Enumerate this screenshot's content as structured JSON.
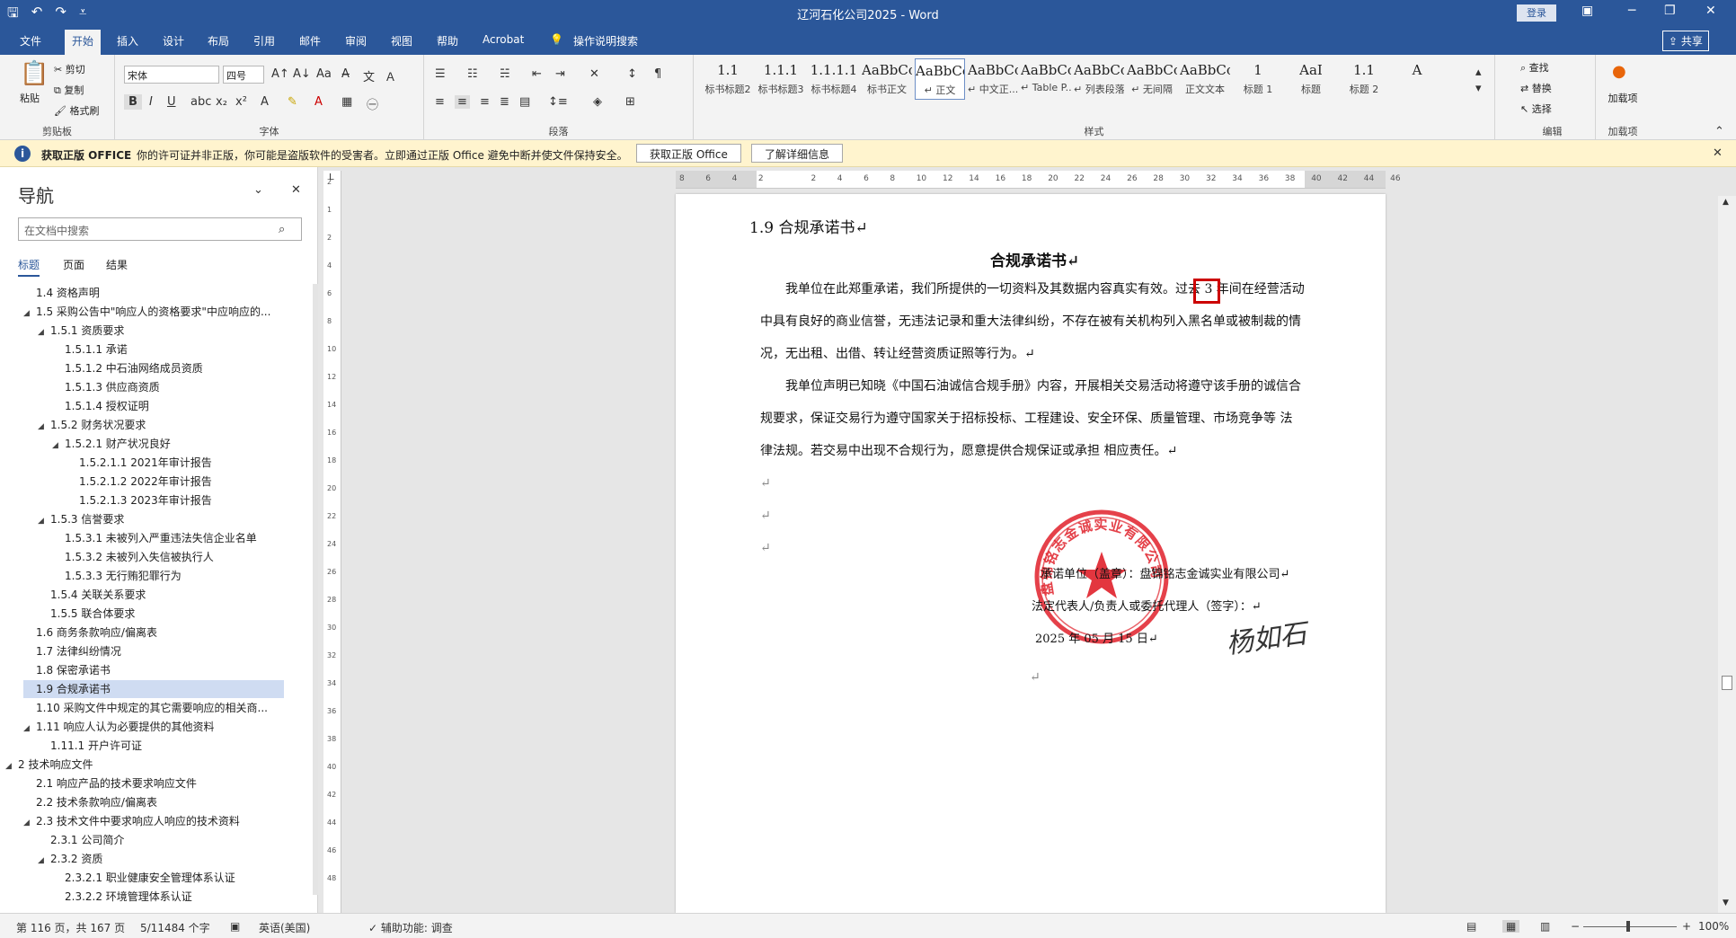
{
  "window": {
    "title": "辽河石化公司2025  -  Word",
    "login_label": "登录"
  },
  "tabs": [
    "文件",
    "开始",
    "插入",
    "设计",
    "布局",
    "引用",
    "邮件",
    "审阅",
    "视图",
    "帮助",
    "Acrobat",
    "操作说明搜索"
  ],
  "share_label": "共享",
  "ribbon": {
    "clipboard": {
      "paste": "粘贴",
      "cut": "剪切",
      "copy": "复制",
      "format_painter": "格式刷",
      "label": "剪贴板"
    },
    "font": {
      "name": "宋体",
      "size": "四号",
      "label": "字体"
    },
    "paragraph": {
      "label": "段落"
    },
    "styles": {
      "label": "样式",
      "items": [
        {
          "preview": "1.1",
          "name": "标书标题2"
        },
        {
          "preview": "1.1.1",
          "name": "标书标题3"
        },
        {
          "preview": "1.1.1.1",
          "name": "标书标题4"
        },
        {
          "preview": "AaBbCcDdE",
          "name": "标书正文"
        },
        {
          "preview": "AaBbCcD",
          "name": "↵ 正文"
        },
        {
          "preview": "AaBbCcDd",
          "name": "↵ 中文正..."
        },
        {
          "preview": "AaBbCcDd",
          "name": "↵ Table P..."
        },
        {
          "preview": "AaBbCcDd",
          "name": "↵ 列表段落"
        },
        {
          "preview": "AaBbCcDd",
          "name": "↵ 无间隔"
        },
        {
          "preview": "AaBbCcDd",
          "name": "正文文本"
        },
        {
          "preview": "1",
          "name": "标题 1"
        },
        {
          "preview": "AaI",
          "name": "标题"
        },
        {
          "preview": "1.1",
          "name": "标题 2"
        },
        {
          "preview": "A",
          "name": ""
        }
      ]
    },
    "editing": {
      "find": "查找",
      "replace": "替换",
      "select": "选择",
      "label": "编辑"
    },
    "addins": {
      "button": "加载项",
      "label": "加载项"
    }
  },
  "infobar": {
    "title": "获取正版 OFFICE",
    "text": "你的许可证并非正版，你可能是盗版软件的受害者。立即通过正版 Office 避免中断并使文件保持安全。",
    "btn1": "获取正版 Office",
    "btn2": "了解详细信息"
  },
  "nav": {
    "title": "导航",
    "search_placeholder": "在文档中搜索",
    "tabs": [
      "标题",
      "页面",
      "结果"
    ],
    "items": [
      {
        "label": "1.4 资格声明",
        "level": 2,
        "tri": ""
      },
      {
        "label": "1.5 采购公告中\"响应人的资格要求\"中应响应的...",
        "level": 2,
        "tri": "◢"
      },
      {
        "label": "1.5.1 资质要求",
        "level": 3,
        "tri": "◢"
      },
      {
        "label": "1.5.1.1 承诺",
        "level": 4,
        "tri": ""
      },
      {
        "label": "1.5.1.2 中石油网络成员资质",
        "level": 4,
        "tri": ""
      },
      {
        "label": "1.5.1.3 供应商资质",
        "level": 4,
        "tri": ""
      },
      {
        "label": "1.5.1.4 授权证明",
        "level": 4,
        "tri": ""
      },
      {
        "label": "1.5.2 财务状况要求",
        "level": 3,
        "tri": "◢"
      },
      {
        "label": "1.5.2.1 财产状况良好",
        "level": 4,
        "tri": "◢"
      },
      {
        "label": "1.5.2.1.1 2021年审计报告",
        "level": 5,
        "tri": ""
      },
      {
        "label": "1.5.2.1.2 2022年审计报告",
        "level": 5,
        "tri": ""
      },
      {
        "label": "1.5.2.1.3 2023年审计报告",
        "level": 5,
        "tri": ""
      },
      {
        "label": "1.5.3 信誉要求",
        "level": 3,
        "tri": "◢"
      },
      {
        "label": "1.5.3.1 未被列入严重违法失信企业名单",
        "level": 4,
        "tri": ""
      },
      {
        "label": "1.5.3.2 未被列入失信被执行人",
        "level": 4,
        "tri": ""
      },
      {
        "label": "1.5.3.3 无行贿犯罪行为",
        "level": 4,
        "tri": ""
      },
      {
        "label": "1.5.4 关联关系要求",
        "level": 3,
        "tri": ""
      },
      {
        "label": "1.5.5 联合体要求",
        "level": 3,
        "tri": ""
      },
      {
        "label": "1.6 商务条款响应/偏离表",
        "level": 2,
        "tri": ""
      },
      {
        "label": "1.7 法律纠纷情况",
        "level": 2,
        "tri": ""
      },
      {
        "label": "1.8 保密承诺书",
        "level": 2,
        "tri": ""
      },
      {
        "label": "1.9 合规承诺书",
        "level": 2,
        "tri": "",
        "selected": true
      },
      {
        "label": "1.10 采购文件中规定的其它需要响应的相关商...",
        "level": 2,
        "tri": ""
      },
      {
        "label": "1.11 响应人认为必要提供的其他资料",
        "level": 2,
        "tri": "◢"
      },
      {
        "label": "1.11.1 开户许可证",
        "level": 3,
        "tri": ""
      },
      {
        "label": "2 技术响应文件",
        "level": 1,
        "tri": "◢"
      },
      {
        "label": "2.1 响应产品的技术要求响应文件",
        "level": 2,
        "tri": ""
      },
      {
        "label": "2.2 技术条款响应/偏离表",
        "level": 2,
        "tri": ""
      },
      {
        "label": "2.3 技术文件中要求响应人响应的技术资料",
        "level": 2,
        "tri": "◢"
      },
      {
        "label": "2.3.1 公司简介",
        "level": 3,
        "tri": ""
      },
      {
        "label": "2.3.2 资质",
        "level": 3,
        "tri": "◢"
      },
      {
        "label": "2.3.2.1 职业健康安全管理体系认证",
        "level": 4,
        "tri": ""
      },
      {
        "label": "2.3.2.2 环境管理体系认证",
        "level": 4,
        "tri": ""
      }
    ]
  },
  "ruler": {
    "numbers": [
      "8",
      "6",
      "4",
      "2",
      "",
      "2",
      "4",
      "6",
      "8",
      "10",
      "12",
      "14",
      "16",
      "18",
      "20",
      "22",
      "24",
      "26",
      "28",
      "30",
      "32",
      "34",
      "36",
      "38",
      "40",
      "42",
      "44",
      "46"
    ]
  },
  "vruler": {
    "numbers": [
      "2",
      "1",
      "2",
      "4",
      "6",
      "8",
      "10",
      "12",
      "14",
      "16",
      "18",
      "20",
      "22",
      "24",
      "26",
      "28",
      "30",
      "32",
      "34",
      "36",
      "38",
      "40",
      "42",
      "44",
      "46",
      "48"
    ]
  },
  "document": {
    "heading": "1.9    合规承诺书↵",
    "title": "合规承诺书↵",
    "para1_lines": [
      "我单位在此郑重承诺，我们所提供的一切资料及其数据内容真实有效。过去 3 年间在经营活动",
      "中具有良好的商业信誉，无违法记录和重大法律纠纷，不存在被有关机构列入黑名单或被制裁的情",
      "况，无出租、出借、转让经营资质证照等行为。↵"
    ],
    "para2_lines": [
      "我单位声明已知晓《中国石油诚信合规手册》内容，开展相关交易活动将遵守该手册的诚信合",
      "规要求，保证交易行为遵守国家关于招标投标、工程建设、安全环保、质量管理、市场竞争等 法",
      "律法规。若交易中出现不合规行为，愿意提供合规保证或承担 相应责任。↵"
    ],
    "blank_mark": "↵",
    "sign_company": "承诺单位（盖章）：盘锦铭志金诚实业有限公司↵",
    "sign_rep": "法定代表人/负责人或委托代理人（签字）：↵",
    "sign_date": "2025 年 05 月 15 日↵",
    "seal_text": "盘锦铭志金诚实业有限公司",
    "signature": "杨如石"
  },
  "status": {
    "page": "第 116 页，共 167 页",
    "words": "5/11484 个字",
    "lang": "英语(美国)",
    "access": "辅助功能: 调查",
    "zoom": "100%"
  },
  "colors": {
    "accent": "#2b579a",
    "seal": "#e0202a",
    "infobar": "#fff4ce"
  }
}
